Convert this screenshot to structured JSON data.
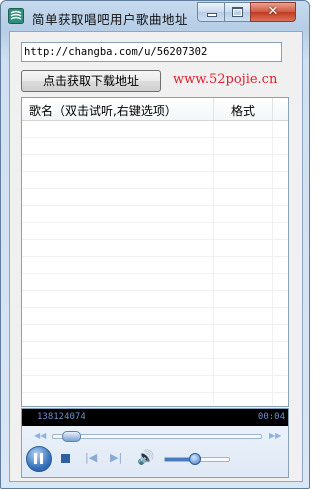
{
  "window": {
    "title": "简单获取唱吧用户歌曲地址",
    "close_glyph": "✕",
    "icon": "app-icon"
  },
  "form": {
    "url_value": "http://changba.com/u/56207302",
    "get_button_label": "点击获取下载地址",
    "site_link": "www.52pojie.cn"
  },
  "list": {
    "columns": [
      {
        "label": "歌名（双击试听,右键选项）"
      },
      {
        "label": "格式"
      }
    ],
    "rows": []
  },
  "player": {
    "status_left": "138124074",
    "status_right": "00:04",
    "seek_progress": 0.05,
    "volume_level": 0.45,
    "state": "playing",
    "icons": {
      "rewind": "rewind-icon",
      "forward": "fast-forward-icon",
      "pause": "pause-icon",
      "stop": "stop-icon",
      "previous": "previous-track-icon",
      "next": "next-track-icon",
      "volume": "speaker-icon"
    }
  },
  "colors": {
    "link": "#e0202a",
    "status_bg": "#000000",
    "status_text": "#6f8fd0",
    "accent": "#2d5fa3"
  }
}
